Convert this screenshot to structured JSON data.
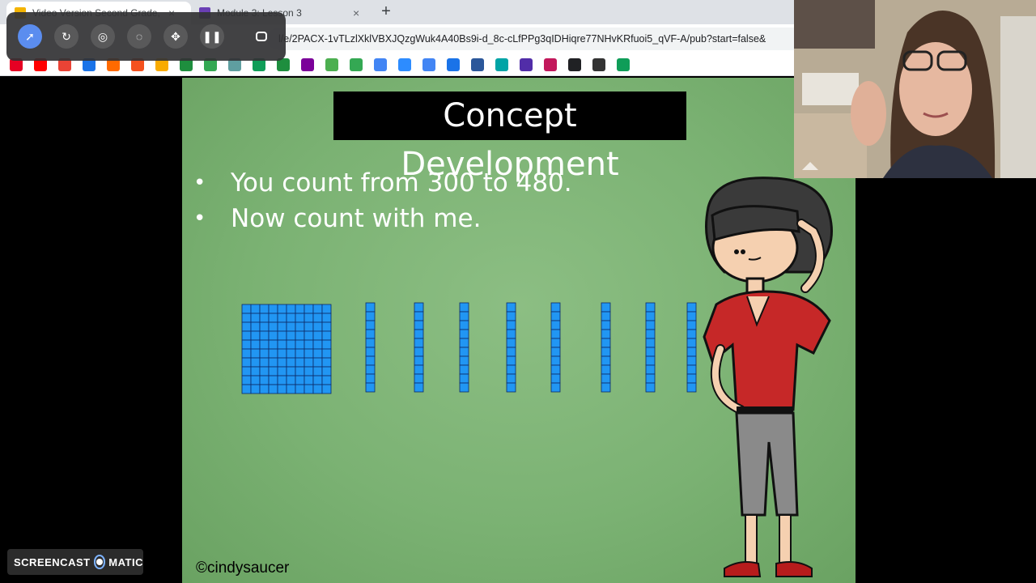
{
  "browser": {
    "tabs": [
      {
        "title": "Video Version Second Grade, M",
        "favicon_color": "#f4b400",
        "active": true
      },
      {
        "title": "Module 3: Lesson 3",
        "favicon_color": "#6a3fb5",
        "active": false
      }
    ],
    "new_tab_symbol": "+",
    "close_symbol": "×",
    "url": "l/e/2PACX-1vTLzlXklVBXJQzgWuk4A40Bs9i-d_8c-cLfPPg3qIDHiqre77NHvKRfuoi5_qVF-A/pub?start=false&",
    "bookmark_colors": [
      "#e60023",
      "#ff0000",
      "#ea4335",
      "#1a73e8",
      "#ff6a00",
      "#f4511e",
      "#f9ab00",
      "#1e8e3e",
      "#34a853",
      "#5f9ea0",
      "#0f9d58",
      "#1e8e3e",
      "#7b0099",
      "#4caf50",
      "#34a853",
      "#4285f4",
      "#2d8cff",
      "#4285f4",
      "#1a73e8",
      "#2b579a",
      "#00a4a6",
      "#512da8",
      "#c2185b",
      "#202124",
      "#333333",
      "#0f9d58"
    ]
  },
  "recorder": {
    "buttons": [
      "pointer-icon",
      "rotate-icon",
      "highlight-icon",
      "shape-icon",
      "move-icon",
      "pause-icon",
      "window-icon"
    ]
  },
  "slide": {
    "title": "Concept Development",
    "bullets": [
      "You count from 300 to 480.",
      "Now count with me."
    ],
    "bullet_symbol": "•",
    "credit": "©cindysaucer",
    "blocks": {
      "hundreds": 1,
      "tens": 8,
      "color": "#2196f3"
    }
  },
  "watermark": {
    "left": "SCREENCAST",
    "right": "MATIC"
  }
}
